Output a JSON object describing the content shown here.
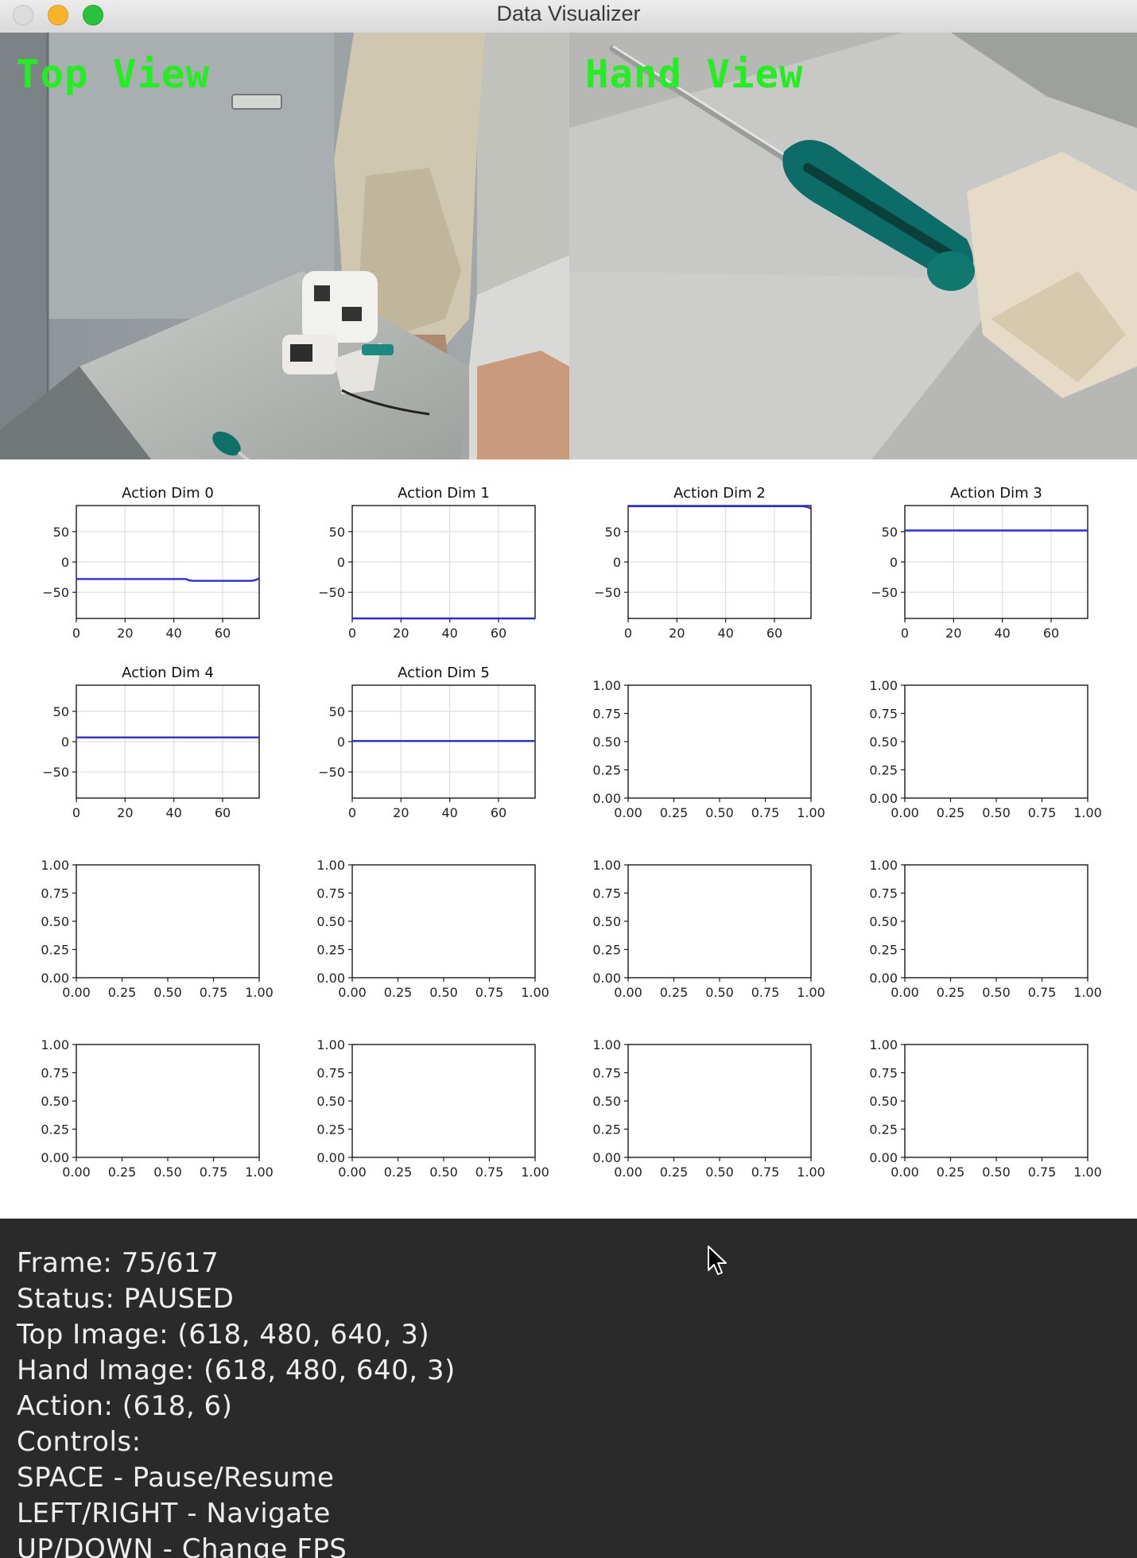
{
  "window": {
    "title": "Data Visualizer"
  },
  "colors": {
    "overlay_label": "#22ee22",
    "series_line": "#2a2aee",
    "info_bg": "#2a2a2a"
  },
  "cameras": [
    {
      "label": "Top View"
    },
    {
      "label": "Hand View"
    }
  ],
  "chart_data": [
    {
      "type": "line",
      "title": "Action Dim 0",
      "xlim": [
        0,
        75
      ],
      "ylim": [
        -93,
        93
      ],
      "xticks": [
        "0",
        "20",
        "40",
        "60"
      ],
      "yticks": [
        "50",
        "0",
        "−50"
      ],
      "grid": true,
      "series": [
        {
          "x": [
            0,
            45,
            46,
            48,
            72,
            74,
            75
          ],
          "y": [
            -28,
            -28,
            -30,
            -31,
            -31,
            -29,
            -27
          ]
        }
      ]
    },
    {
      "type": "line",
      "title": "Action Dim 1",
      "xlim": [
        0,
        75
      ],
      "ylim": [
        -93,
        93
      ],
      "xticks": [
        "0",
        "20",
        "40",
        "60"
      ],
      "yticks": [
        "50",
        "0",
        "−50"
      ],
      "grid": true,
      "series": [
        {
          "x": [
            0,
            75
          ],
          "y": [
            -93,
            -93
          ]
        }
      ]
    },
    {
      "type": "line",
      "title": "Action Dim 2",
      "xlim": [
        0,
        75
      ],
      "ylim": [
        -93,
        93
      ],
      "xticks": [
        "0",
        "20",
        "40",
        "60"
      ],
      "yticks": [
        "50",
        "0",
        "−50"
      ],
      "grid": true,
      "series": [
        {
          "x": [
            0,
            72,
            74,
            75
          ],
          "y": [
            92,
            92,
            90,
            88
          ]
        }
      ]
    },
    {
      "type": "line",
      "title": "Action Dim 3",
      "xlim": [
        0,
        75
      ],
      "ylim": [
        -93,
        93
      ],
      "xticks": [
        "0",
        "20",
        "40",
        "60"
      ],
      "yticks": [
        "50",
        "0",
        "−50"
      ],
      "grid": true,
      "series": [
        {
          "x": [
            0,
            75
          ],
          "y": [
            52,
            52
          ]
        }
      ]
    },
    {
      "type": "line",
      "title": "Action Dim 4",
      "xlim": [
        0,
        75
      ],
      "ylim": [
        -93,
        93
      ],
      "xticks": [
        "0",
        "20",
        "40",
        "60"
      ],
      "yticks": [
        "50",
        "0",
        "−50"
      ],
      "grid": true,
      "series": [
        {
          "x": [
            0,
            75
          ],
          "y": [
            7,
            7
          ]
        }
      ]
    },
    {
      "type": "line",
      "title": "Action Dim 5",
      "xlim": [
        0,
        75
      ],
      "ylim": [
        -93,
        93
      ],
      "xticks": [
        "0",
        "20",
        "40",
        "60"
      ],
      "yticks": [
        "50",
        "0",
        "−50"
      ],
      "grid": true,
      "series": [
        {
          "x": [
            0,
            75
          ],
          "y": [
            1,
            1
          ]
        }
      ]
    },
    {
      "type": "line",
      "title": "",
      "xlim": [
        0,
        1
      ],
      "ylim": [
        0,
        1
      ],
      "grid": false,
      "xticks": [
        "0.00",
        "0.25",
        "0.50",
        "0.75",
        "1.00"
      ],
      "yticks": [
        "1.00",
        "0.75",
        "0.50",
        "0.25",
        "0.00"
      ],
      "series": []
    },
    {
      "type": "line",
      "title": "",
      "xlim": [
        0,
        1
      ],
      "ylim": [
        0,
        1
      ],
      "grid": false,
      "xticks": [
        "0.00",
        "0.25",
        "0.50",
        "0.75",
        "1.00"
      ],
      "yticks": [
        "1.00",
        "0.75",
        "0.50",
        "0.25",
        "0.00"
      ],
      "series": []
    },
    {
      "type": "line",
      "title": "",
      "xlim": [
        0,
        1
      ],
      "ylim": [
        0,
        1
      ],
      "grid": false,
      "xticks": [
        "0.00",
        "0.25",
        "0.50",
        "0.75",
        "1.00"
      ],
      "yticks": [
        "1.00",
        "0.75",
        "0.50",
        "0.25",
        "0.00"
      ],
      "series": []
    },
    {
      "type": "line",
      "title": "",
      "xlim": [
        0,
        1
      ],
      "ylim": [
        0,
        1
      ],
      "grid": false,
      "xticks": [
        "0.00",
        "0.25",
        "0.50",
        "0.75",
        "1.00"
      ],
      "yticks": [
        "1.00",
        "0.75",
        "0.50",
        "0.25",
        "0.00"
      ],
      "series": []
    },
    {
      "type": "line",
      "title": "",
      "xlim": [
        0,
        1
      ],
      "ylim": [
        0,
        1
      ],
      "grid": false,
      "xticks": [
        "0.00",
        "0.25",
        "0.50",
        "0.75",
        "1.00"
      ],
      "yticks": [
        "1.00",
        "0.75",
        "0.50",
        "0.25",
        "0.00"
      ],
      "series": []
    },
    {
      "type": "line",
      "title": "",
      "xlim": [
        0,
        1
      ],
      "ylim": [
        0,
        1
      ],
      "grid": false,
      "xticks": [
        "0.00",
        "0.25",
        "0.50",
        "0.75",
        "1.00"
      ],
      "yticks": [
        "1.00",
        "0.75",
        "0.50",
        "0.25",
        "0.00"
      ],
      "series": []
    },
    {
      "type": "line",
      "title": "",
      "xlim": [
        0,
        1
      ],
      "ylim": [
        0,
        1
      ],
      "grid": false,
      "xticks": [
        "0.00",
        "0.25",
        "0.50",
        "0.75",
        "1.00"
      ],
      "yticks": [
        "1.00",
        "0.75",
        "0.50",
        "0.25",
        "0.00"
      ],
      "series": []
    },
    {
      "type": "line",
      "title": "",
      "xlim": [
        0,
        1
      ],
      "ylim": [
        0,
        1
      ],
      "grid": false,
      "xticks": [
        "0.00",
        "0.25",
        "0.50",
        "0.75",
        "1.00"
      ],
      "yticks": [
        "1.00",
        "0.75",
        "0.50",
        "0.25",
        "0.00"
      ],
      "series": []
    },
    {
      "type": "line",
      "title": "",
      "xlim": [
        0,
        1
      ],
      "ylim": [
        0,
        1
      ],
      "grid": false,
      "xticks": [
        "0.00",
        "0.25",
        "0.50",
        "0.75",
        "1.00"
      ],
      "yticks": [
        "1.00",
        "0.75",
        "0.50",
        "0.25",
        "0.00"
      ],
      "series": []
    },
    {
      "type": "line",
      "title": "",
      "xlim": [
        0,
        1
      ],
      "ylim": [
        0,
        1
      ],
      "grid": false,
      "xticks": [
        "0.00",
        "0.25",
        "0.50",
        "0.75",
        "1.00"
      ],
      "yticks": [
        "1.00",
        "0.75",
        "0.50",
        "0.25",
        "0.00"
      ],
      "series": []
    }
  ],
  "info": {
    "lines": [
      "Frame: 75/617",
      "Status: PAUSED",
      "Top Image: (618, 480, 640, 3)",
      "Hand Image: (618, 480, 640, 3)",
      "Action: (618, 6)",
      "Controls:",
      "SPACE - Pause/Resume",
      "LEFT/RIGHT - Navigate",
      "UP/DOWN - Change FPS"
    ]
  },
  "cursor": {
    "icon": "arrow-pointer-icon"
  }
}
